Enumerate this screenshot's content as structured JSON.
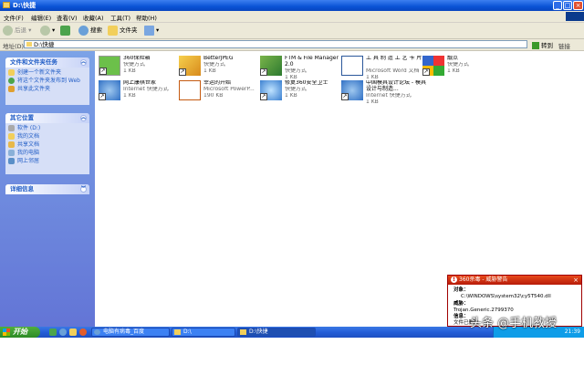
{
  "window": {
    "title": "D:\\快捷"
  },
  "menu": [
    "文件(F)",
    "编辑(E)",
    "查看(V)",
    "收藏(A)",
    "工具(T)",
    "帮助(H)"
  ],
  "toolbar": {
    "back": "后退",
    "search": "搜索",
    "folders": "文件夹"
  },
  "address": {
    "label": "地址(D)",
    "value": "D:\\快捷",
    "go": "转到",
    "links": "链接"
  },
  "tasks_panel": {
    "title": "文件和文件夹任务",
    "items": [
      "创建一个新文件夹",
      "将这个文件夹发布到 Web",
      "共享此文件夹"
    ]
  },
  "places_panel": {
    "title": "其它位置",
    "items": [
      "软件 (D:)",
      "我的文档",
      "共享文档",
      "我的电脑",
      "网上邻居"
    ]
  },
  "details_panel": {
    "title": "详细信息"
  },
  "files": [
    {
      "name": "360保险箱",
      "type": "快捷方式",
      "size": "1 KB"
    },
    {
      "name": "BetterJPEG",
      "type": "快捷方式",
      "size": "1 KB"
    },
    {
      "name": "FTM & File Manager 2.0",
      "type": "快捷方式",
      "size": "1 KB"
    },
    {
      "name": "工 具 制 造 工 艺 卡 片",
      "type": "Microsoft Word 文档",
      "size": "1 KB"
    },
    {
      "name": "靓点",
      "type": "快捷方式",
      "size": "1 KB"
    },
    {
      "name": "网上康棋世家",
      "type": "Internet 快捷方式",
      "size": "1 KB"
    },
    {
      "name": "幸运的开始",
      "type": "Microsoft PowerP...",
      "size": "190 KB"
    },
    {
      "name": "修复360安全卫士",
      "type": "快捷方式",
      "size": "1 KB"
    },
    {
      "name": "中国模具设计论坛 - 模具设计与制造...",
      "type": "Internet 快捷方式",
      "size": "1 KB"
    }
  ],
  "popup": {
    "title": "360杀毒 - 威胁警告",
    "object_label": "对象：",
    "object_value": "C:\\WINDOWS\\system32\\cy5T540.dll",
    "threat_label": "威胁：",
    "threat_value": "Trojan.Generic.2799370",
    "info_label": "信息：",
    "info_value": "文件已删除"
  },
  "taskbar": {
    "start": "开始",
    "tasks": [
      "电脑有病毒_百度",
      "D:\\",
      "D:\\快捷"
    ],
    "clock": "21:39"
  },
  "watermark": "头条 @手机教授"
}
